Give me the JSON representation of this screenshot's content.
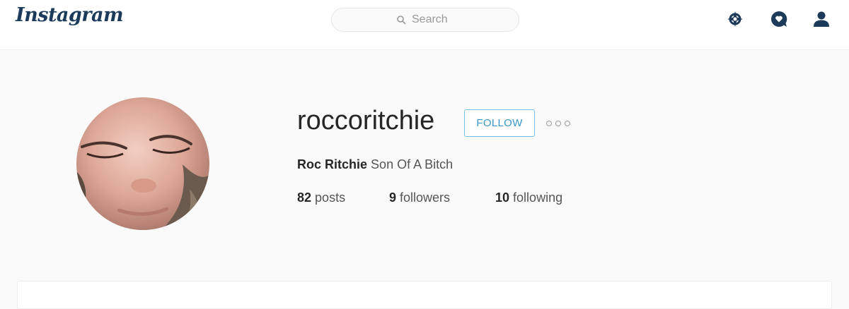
{
  "header": {
    "logo_text": "Instagram",
    "search": {
      "placeholder": "Search",
      "icon": "search-icon"
    },
    "nav_icons": [
      "explore-compass-icon",
      "activity-heart-icon",
      "profile-person-icon"
    ]
  },
  "profile": {
    "username": "roccoritchie",
    "follow_label": "FOLLOW",
    "more_options_icon": "more-options-icon",
    "full_name": "Roc Ritchie",
    "bio": "Son Of A Bitch",
    "stats": {
      "posts": {
        "count": "82",
        "label": "posts"
      },
      "followers": {
        "count": "9",
        "label": "followers"
      },
      "following": {
        "count": "10",
        "label": "following"
      }
    }
  },
  "colors": {
    "brand": "#1c3b5a",
    "follow_border": "#70c0e7",
    "follow_text": "#3897c6",
    "background": "#fafafa"
  }
}
